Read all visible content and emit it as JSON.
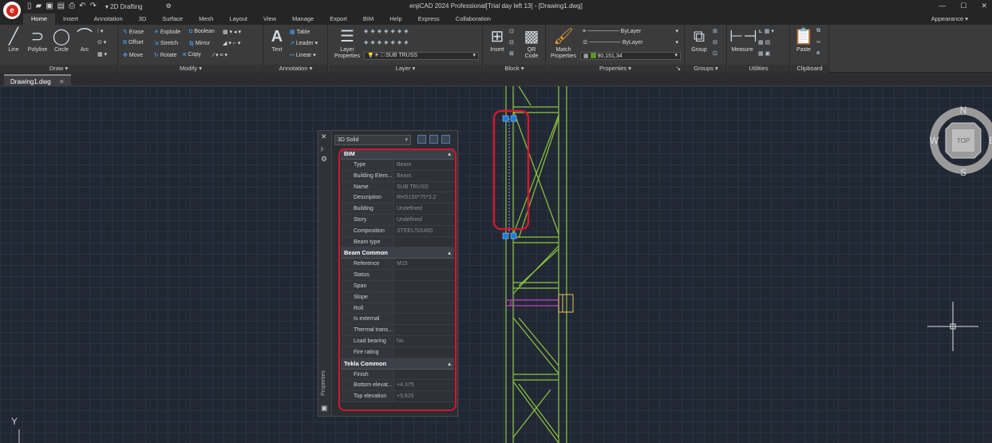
{
  "app": {
    "title": "enjiCAD 2024 Professional[Trial day left 13] - [Drawing1.dwg]",
    "logo_letter": "e",
    "workspace": "2D Drafting",
    "appearance": "Appearance"
  },
  "qat_icons": [
    "new-icon",
    "open-icon",
    "save-icon",
    "saveas-icon",
    "print-icon",
    "undo-icon",
    "redo-icon"
  ],
  "ribbon_tabs": [
    "Home",
    "Insert",
    "Annotation",
    "3D",
    "Surface",
    "Mesh",
    "Layout",
    "View",
    "Manage",
    "Export",
    "BIM",
    "Help",
    "Express",
    "Collaboration"
  ],
  "ribbon": {
    "draw": {
      "title": "Draw",
      "line": "Line",
      "polyline": "Polyline",
      "circle": "Circle",
      "arc": "Arc"
    },
    "modify": {
      "title": "Modify",
      "erase": "Erase",
      "explode": "Explode",
      "boolean": "Boolean",
      "offset": "Offset",
      "stretch": "Stretch",
      "mirror": "Mirror",
      "move": "Move",
      "rotate": "Rotate",
      "copy": "Copy"
    },
    "annotation": {
      "title": "Annotation",
      "text": "Text",
      "table": "Table",
      "leader": "Leader",
      "linear": "Linear"
    },
    "layer": {
      "title": "Layer",
      "layer_properties": "Layer Properties",
      "current_layer": "SUB TRUSS"
    },
    "block": {
      "title": "Block",
      "insert": "Insert",
      "qr_code": "QR Code"
    },
    "properties": {
      "title": "Properties",
      "match": "Match Properties",
      "linetype": "ByLayer",
      "lineweight": "ByLayer",
      "color": "90,151,34",
      "color_hex": "#5a9722"
    },
    "groups": {
      "title": "Groups",
      "group": "Group"
    },
    "utilities": {
      "title": "Utilities",
      "measure": "Measure"
    },
    "clipboard": {
      "title": "Clipboard",
      "paste": "Paste"
    }
  },
  "document": {
    "tab": "Drawing1.dwg"
  },
  "viewcube": {
    "top": "TOP",
    "n": "N",
    "s": "S",
    "w": "W",
    "e": "E"
  },
  "ucs": {
    "y": "Y"
  },
  "properties_palette": {
    "object_type": "3D Solid",
    "side_label": "Properties",
    "categories": [
      {
        "name": "BIM",
        "rows": [
          {
            "k": "Type",
            "v": "Beam"
          },
          {
            "k": "Building Elem...",
            "v": "Beam"
          },
          {
            "k": "Name",
            "v": "SUB TRUSS"
          },
          {
            "k": "Description",
            "v": "RHS150*75*3.2"
          },
          {
            "k": "Building",
            "v": "Undefined"
          },
          {
            "k": "Story",
            "v": "Undefined"
          },
          {
            "k": "Composition",
            "v": "STEEL/SS400"
          },
          {
            "k": "Beam type",
            "v": ""
          }
        ]
      },
      {
        "name": "Beam Common",
        "rows": [
          {
            "k": "Reference",
            "v": "M15"
          },
          {
            "k": "Status",
            "v": ""
          },
          {
            "k": "Span",
            "v": ""
          },
          {
            "k": "Slope",
            "v": ""
          },
          {
            "k": "Roll",
            "v": ""
          },
          {
            "k": "Is external",
            "v": ""
          },
          {
            "k": "Thermal trans...",
            "v": ""
          },
          {
            "k": "Load bearing",
            "v": "No"
          },
          {
            "k": "Fire rating",
            "v": ""
          }
        ]
      },
      {
        "name": "Tekla Common",
        "rows": [
          {
            "k": "Finish",
            "v": ""
          },
          {
            "k": "Bottom elevat...",
            "v": "+4.375"
          },
          {
            "k": "Top elevation",
            "v": "+5.825"
          }
        ]
      }
    ]
  },
  "colors": {
    "accent": "#d1182e",
    "truss": "#8dc63f",
    "grip": "#1e7ad6",
    "magenta": "#c040c0"
  }
}
